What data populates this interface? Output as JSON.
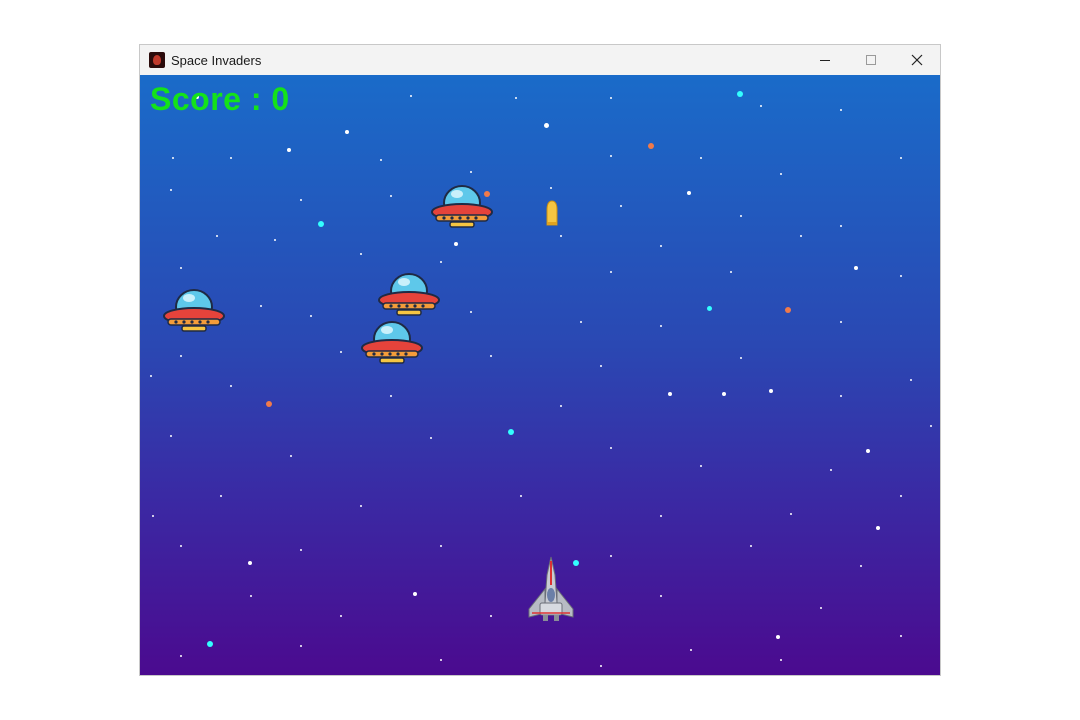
{
  "window": {
    "title": "Space Invaders",
    "app_icon": "space-invaders-app-icon",
    "controls": [
      "minimize",
      "maximize",
      "close"
    ]
  },
  "game": {
    "score_label": "Score : 0",
    "colors": {
      "score": "#14e21a",
      "sky_top": "#1a6bc9",
      "sky_bottom": "#4b0a8f"
    },
    "sprites": {
      "enemy": "ufo-enemy",
      "player": "spaceship-player",
      "bullet": "yellow-bullet"
    }
  }
}
